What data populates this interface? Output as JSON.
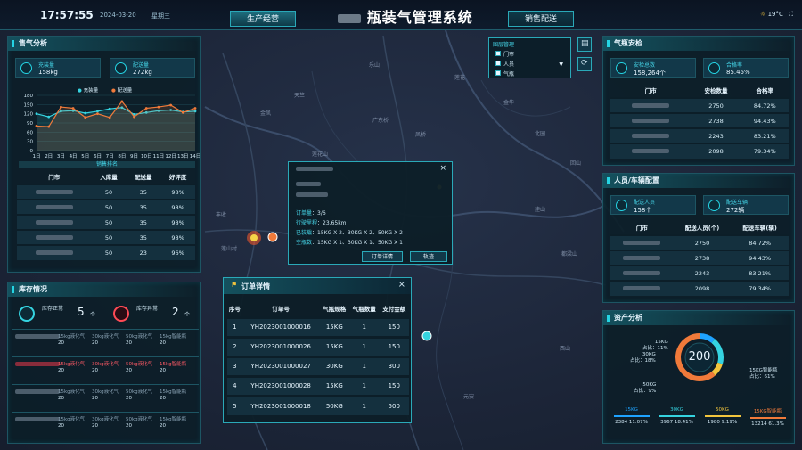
{
  "header": {
    "time": "17:57:55",
    "date": "2024-03-20",
    "weekday": "星期三",
    "title": "瓶装气管理系统",
    "tab_left": "生产经营",
    "tab_right": "销售配送",
    "weather": "19°C"
  },
  "map": {
    "labels": [
      "乐山",
      "莲花",
      "天竺",
      "广东桥",
      "凤桥",
      "金凤",
      "金华",
      "北园",
      "回山",
      "建山",
      "都梁山",
      "元安",
      "西山",
      "丰收",
      "莲花山",
      "莲山村"
    ]
  },
  "filter": {
    "title": "图层管理",
    "items": [
      "门市",
      "人员",
      "气瓶"
    ]
  },
  "gas_analysis": {
    "title": "售气分析",
    "stats": [
      {
        "label": "充装量",
        "value": "158kg"
      },
      {
        "label": "配送量",
        "value": "272kg"
      }
    ],
    "rank_title": "销售排名",
    "columns": [
      "门市",
      "入库量",
      "配送量",
      "好评度"
    ],
    "rows": [
      [
        "50",
        "35",
        "98%"
      ],
      [
        "50",
        "35",
        "98%"
      ],
      [
        "50",
        "35",
        "98%"
      ],
      [
        "50",
        "35",
        "98%"
      ],
      [
        "50",
        "23",
        "96%"
      ]
    ]
  },
  "chart_data": {
    "type": "line",
    "categories": [
      "1日",
      "2日",
      "3日",
      "4日",
      "5日",
      "6日",
      "7日",
      "8日",
      "9日",
      "10日",
      "11日",
      "12日",
      "13日",
      "14日"
    ],
    "ylim": [
      0,
      180
    ],
    "yticks": [
      0,
      30,
      60,
      90,
      120,
      150,
      180
    ],
    "series": [
      {
        "name": "充装量",
        "values": [
          120,
          110,
          128,
          130,
          122,
          128,
          136,
          140,
          118,
          124,
          130,
          132,
          126,
          128
        ],
        "color": "#35d3e0"
      },
      {
        "name": "配送量",
        "values": [
          80,
          78,
          142,
          138,
          108,
          120,
          108,
          160,
          110,
          138,
          142,
          148,
          124,
          138
        ],
        "color": "#f07a3a"
      }
    ]
  },
  "stock": {
    "title": "库存情况",
    "normal_label": "库存正常",
    "normal_value": "5",
    "normal_unit": "个",
    "abnormal_label": "库存异常",
    "abnormal_value": "2",
    "abnormal_unit": "个",
    "items": [
      {
        "cells": [
          "15kg液化气",
          "30kg液化气",
          "50kg液化气",
          "15kg智能瓶"
        ],
        "nums": [
          "20",
          "20",
          "20",
          "20"
        ],
        "alert": false
      },
      {
        "cells": [
          "15kg液化气",
          "30kg液化气",
          "50kg液化气",
          "15kg智能瓶"
        ],
        "nums": [
          "20",
          "20",
          "20",
          "20"
        ],
        "alert": true
      },
      {
        "cells": [
          "15kg液化气",
          "30kg液化气",
          "50kg液化气",
          "15kg智能瓶"
        ],
        "nums": [
          "20",
          "20",
          "20",
          "20"
        ],
        "alert": false
      },
      {
        "cells": [
          "15kg液化气",
          "30kg液化气",
          "50kg液化气",
          "15kg智能瓶"
        ],
        "nums": [
          "20",
          "20",
          "20",
          "20"
        ],
        "alert": false
      }
    ]
  },
  "popup": {
    "fields": [
      {
        "k": "订单量",
        "v": "3/6"
      },
      {
        "k": "行驶里程",
        "v": "23.65km"
      },
      {
        "k": "已装载",
        "v": "15KG X 2、30KG X 2、50KG X 2"
      },
      {
        "k": "空瓶数",
        "v": "15KG X 1、30KG X 1、50KG X 1"
      }
    ],
    "btn_detail": "订单详情",
    "btn_track": "轨迹"
  },
  "orders": {
    "title": "订单详情",
    "columns": [
      "序号",
      "订单号",
      "气瓶规格",
      "气瓶数量",
      "支付金额"
    ],
    "rows": [
      [
        "1",
        "YH2023001000016",
        "15KG",
        "1",
        "150"
      ],
      [
        "2",
        "YH2023001000026",
        "15KG",
        "1",
        "150"
      ],
      [
        "3",
        "YH2023001000027",
        "30KG",
        "1",
        "300"
      ],
      [
        "4",
        "YH2023001000028",
        "15KG",
        "1",
        "150"
      ],
      [
        "5",
        "YH2023001000018",
        "50KG",
        "1",
        "500"
      ]
    ]
  },
  "safety": {
    "title": "气瓶安检",
    "stats": [
      {
        "label": "安检总数",
        "value": "158,264个"
      },
      {
        "label": "合格率",
        "value": "85.45%"
      }
    ],
    "columns": [
      "门市",
      "安检数量",
      "合格率"
    ],
    "rows": [
      [
        "2750",
        "84.72%"
      ],
      [
        "2738",
        "94.43%"
      ],
      [
        "2243",
        "83.21%"
      ],
      [
        "2098",
        "79.34%"
      ]
    ]
  },
  "staff": {
    "title": "人员/车辆配置",
    "stats": [
      {
        "label": "配送人员",
        "value": "158个"
      },
      {
        "label": "配送车辆",
        "value": "272辆"
      }
    ],
    "columns": [
      "门市",
      "配送人员(个)",
      "配送车辆(辆)"
    ],
    "rows": [
      [
        "2750",
        "84.72%"
      ],
      [
        "2738",
        "94.43%"
      ],
      [
        "2243",
        "83.21%"
      ],
      [
        "2098",
        "79.34%"
      ]
    ]
  },
  "assets": {
    "title": "资产分析",
    "total": "200",
    "donut_labels": [
      {
        "name": "15KG",
        "pct": "11%"
      },
      {
        "name": "30KG",
        "pct": "18%"
      },
      {
        "name": "50KG",
        "pct": "9%"
      },
      {
        "name": "15KG智能瓶",
        "pct": "61%"
      }
    ],
    "pct_prefix": "占比：",
    "slices": [
      {
        "value": 11.07,
        "color": "#1ea3ff"
      },
      {
        "value": 18.41,
        "color": "#35d3e0"
      },
      {
        "value": 9.19,
        "color": "#f2c53d"
      },
      {
        "value": 61.3,
        "color": "#f07a3a"
      }
    ],
    "legend": [
      {
        "name": "15KG",
        "count": "2384",
        "pct": "11.07%"
      },
      {
        "name": "30KG",
        "count": "3967",
        "pct": "18.41%"
      },
      {
        "name": "50KG",
        "count": "1980",
        "pct": "9.19%"
      },
      {
        "name": "15KG智能瓶",
        "count": "13214",
        "pct": "61.3%"
      }
    ]
  }
}
